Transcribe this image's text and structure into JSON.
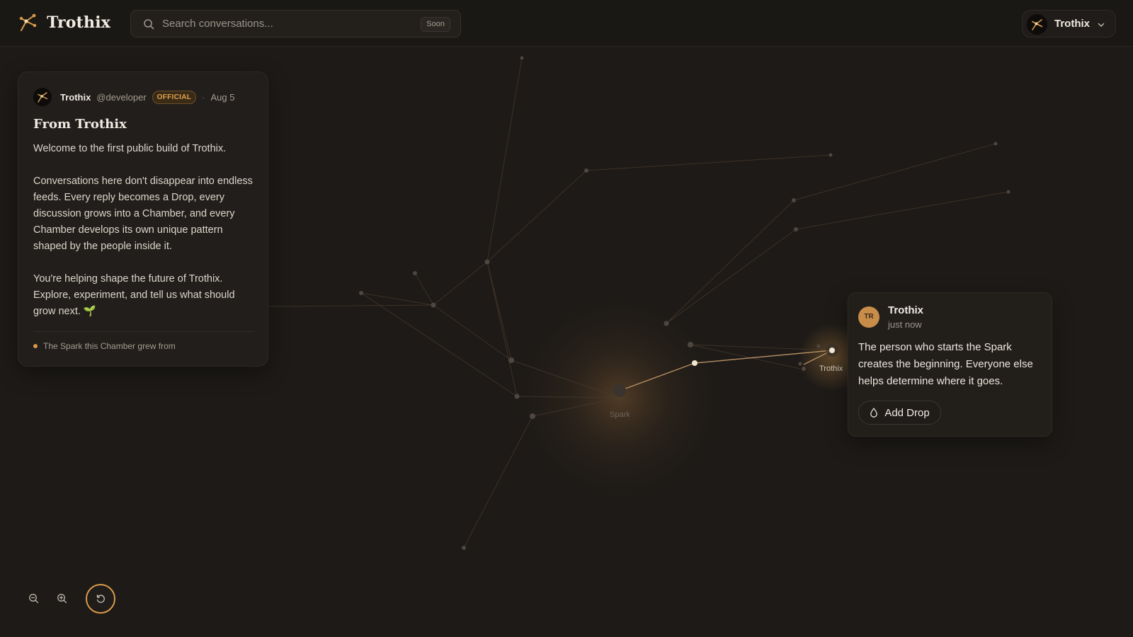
{
  "app": {
    "name": "Trothix"
  },
  "search": {
    "placeholder": "Search conversations...",
    "badge": "Soon"
  },
  "account": {
    "name": "Trothix"
  },
  "post": {
    "author": "Trothix",
    "handle": "@developer",
    "badge": "OFFICIAL",
    "date": "Aug 5",
    "title": "From Trothix",
    "paragraphs": [
      "Welcome to the first public build of Trothix.",
      "Conversations here don't disappear into endless feeds. Every reply becomes a Drop, every discussion grows into a Chamber, and every Chamber develops its own unique pattern shaped by the people inside it.",
      "You're helping shape the future of Trothix. Explore, experiment, and tell us what should grow next. 🌱"
    ],
    "footer": "The Spark this Chamber grew from"
  },
  "graph": {
    "labels": {
      "spark": "Spark",
      "active": "Trothix"
    }
  },
  "drop": {
    "avatar_initials": "TR",
    "author": "Trothix",
    "time": "just now",
    "text": "The person who starts the Spark creates the beginning. Everyone else helps determine where it goes.",
    "button": "Add Drop"
  },
  "controls": {
    "zoom_out_icon": "zoom-out-icon",
    "zoom_in_icon": "zoom-in-icon",
    "reset_icon": "reset-view-icon"
  },
  "colors": {
    "background": "#1d1a17",
    "accent": "#d99a4a",
    "official_badge": "#e0a24f",
    "avatar": "#c98d4a"
  }
}
